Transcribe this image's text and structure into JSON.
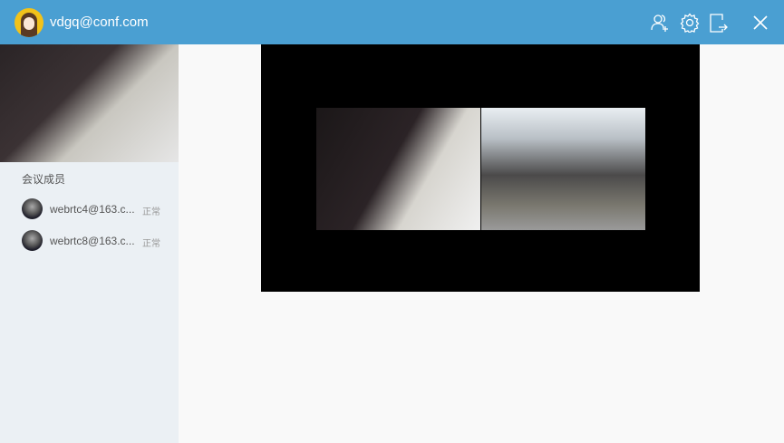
{
  "header": {
    "username": "vdgq@conf.com",
    "icons": [
      "add-user-icon",
      "gear-icon",
      "exit-icon",
      "close-icon"
    ]
  },
  "sidebar": {
    "section_title": "会议成员",
    "members": [
      {
        "name": "webrtc4@163.c...",
        "status": "正常"
      },
      {
        "name": "webrtc8@163.c...",
        "status": "正常"
      }
    ]
  },
  "colors": {
    "header": "#4a9fd2",
    "sidebar": "#ebf0f4",
    "stage": "#000000"
  }
}
